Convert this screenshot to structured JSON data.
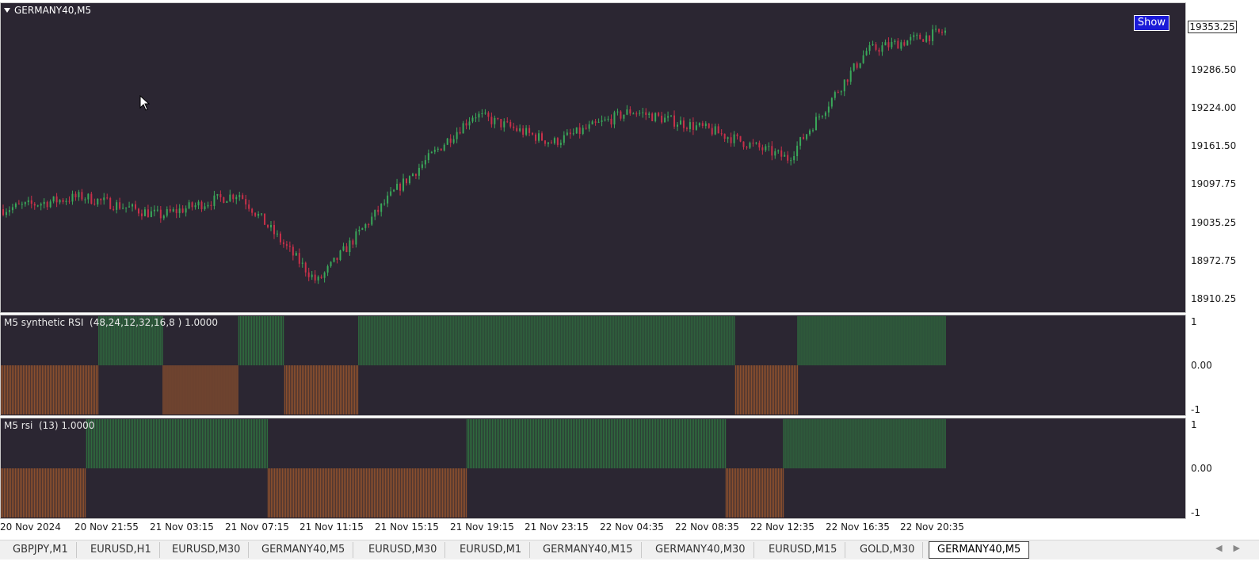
{
  "chart_window": {
    "symbol_title": "GERMANY40,M5",
    "show_button_label": "Show",
    "current_price": "19353.25"
  },
  "panes": {
    "main": {
      "price_labels": [
        "19286.50",
        "19224.00",
        "19161.50",
        "19097.75",
        "19035.25",
        "18972.75",
        "18910.25"
      ]
    },
    "indicator_1": {
      "label": "M5 synthetic RSI  (48,24,12,32,16,8 ) 1.0000",
      "scale_labels": [
        "1",
        "0.00",
        "-1"
      ]
    },
    "indicator_2": {
      "label": "M5 rsi  (13) 1.0000",
      "scale_labels": [
        "1",
        "0.00",
        "-1"
      ]
    }
  },
  "time_axis": [
    "20 Nov 2024",
    "20 Nov 21:55",
    "21 Nov 03:15",
    "21 Nov 07:15",
    "21 Nov 11:15",
    "21 Nov 15:15",
    "21 Nov 19:15",
    "21 Nov 23:15",
    "22 Nov 04:35",
    "22 Nov 08:35",
    "22 Nov 12:35",
    "22 Nov 16:35",
    "22 Nov 20:35"
  ],
  "tabs": [
    "GBPJPY,M1",
    "EURUSD,H1",
    "EURUSD,M30",
    "GERMANY40,M5",
    "EURUSD,M30",
    "EURUSD,M1",
    "GERMANY40,M15",
    "GERMANY40,M30",
    "EURUSD,M15",
    "GOLD,M30",
    "GERMANY40,M5"
  ],
  "active_tab_index": 10,
  "colors": {
    "background": "#2b2632",
    "bull": "#3aa85a",
    "bear": "#c8304a",
    "ind_green": "#2f6a3e",
    "ind_orange": "#8a4f2e"
  },
  "chart_data": [
    {
      "type": "candlestick",
      "title": "GERMANY40,M5",
      "ylim": [
        18885,
        19375
      ],
      "close_series": {
        "x": [
          "20 Nov 2024",
          "20 Nov 21:55",
          "21 Nov 03:15",
          "21 Nov 07:15",
          "21 Nov 11:15",
          "21 Nov 15:15",
          "21 Nov 19:15",
          "21 Nov 23:15",
          "22 Nov 04:35",
          "22 Nov 08:35",
          "22 Nov 12:35",
          "22 Nov 16:35",
          "22 Nov 20:35"
        ],
        "y": [
          19050,
          19070,
          19040,
          19075,
          18935,
          19080,
          19200,
          19155,
          19205,
          19175,
          19130,
          19300,
          19330
        ]
      },
      "extremes": {
        "low": 18895,
        "high": 19365,
        "last": 19353.25
      }
    },
    {
      "type": "bar",
      "title": "M5 synthetic RSI  (48,24,12,32,16,8 ) 1.0000",
      "ylim": [
        -1,
        1
      ],
      "segments": [
        {
          "from": 0.0,
          "to": 0.0824,
          "value": -1
        },
        {
          "from": 0.0824,
          "to": 0.1366,
          "value": 1
        },
        {
          "from": 0.1366,
          "to": 0.2004,
          "value": -1
        },
        {
          "from": 0.2004,
          "to": 0.2391,
          "value": 1
        },
        {
          "from": 0.2391,
          "to": 0.3015,
          "value": -1
        },
        {
          "from": 0.3015,
          "to": 0.6192,
          "value": 1
        },
        {
          "from": 0.6192,
          "to": 0.6717,
          "value": -1
        },
        {
          "from": 0.6717,
          "to": 0.7969,
          "value": 1
        }
      ]
    },
    {
      "type": "bar",
      "title": "M5 rsi  (13) 1.0000",
      "ylim": [
        -1,
        1
      ],
      "segments": [
        {
          "from": 0.0,
          "to": 0.0721,
          "value": -1
        },
        {
          "from": 0.0721,
          "to": 0.2251,
          "value": 1
        },
        {
          "from": 0.2251,
          "to": 0.3928,
          "value": -1
        },
        {
          "from": 0.3928,
          "to": 0.6112,
          "value": 1
        },
        {
          "from": 0.6112,
          "to": 0.6597,
          "value": -1
        },
        {
          "from": 0.6597,
          "to": 0.7969,
          "value": 1
        }
      ]
    }
  ]
}
